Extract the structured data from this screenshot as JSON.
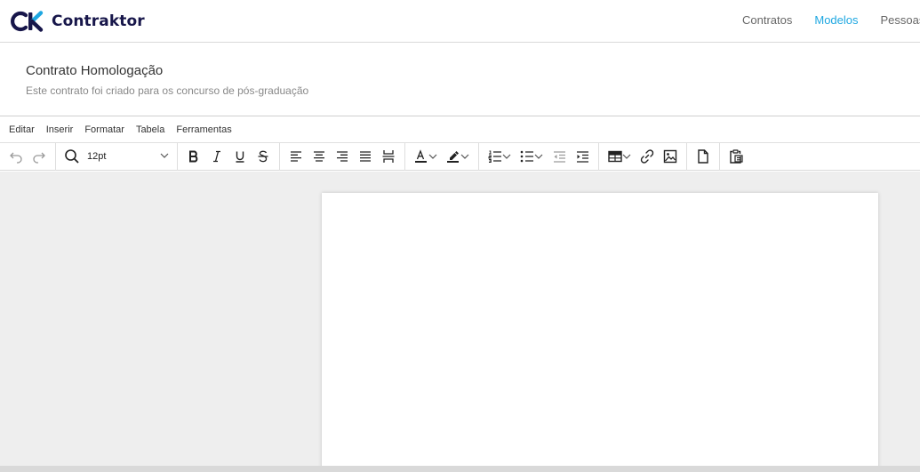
{
  "app": {
    "brand": "Contraktor",
    "brand_color": "#17164a",
    "accent_color": "#1ea7e1"
  },
  "nav": {
    "items": [
      {
        "label": "Contratos",
        "active": false
      },
      {
        "label": "Modelos",
        "active": true
      },
      {
        "label": "Pessoas",
        "active": false
      }
    ]
  },
  "document": {
    "title": "Contrato Homologação",
    "description": "Este contrato foi criado para os concurso de pós-graduação"
  },
  "editor": {
    "menu": [
      "Editar",
      "Inserir",
      "Formatar",
      "Tabela",
      "Ferramentas"
    ],
    "font_size": "12pt",
    "toolbar_icons": {
      "undo": "undo-icon",
      "redo": "redo-icon",
      "search": "search-icon",
      "bold": "bold-icon",
      "italic": "italic-icon",
      "underline": "underline-icon",
      "strikethrough": "strikethrough-icon",
      "align_left": "align-left-icon",
      "align_center": "align-center-icon",
      "align_right": "align-right-icon",
      "align_justify": "align-justify-icon",
      "page_break": "page-break-icon",
      "text_color": "text-color-icon",
      "highlight": "highlight-icon",
      "numbered_list": "numbered-list-icon",
      "bullet_list": "bullet-list-icon",
      "outdent": "outdent-icon",
      "indent": "indent-icon",
      "table": "table-icon",
      "link": "link-icon",
      "image": "image-icon",
      "document": "document-icon",
      "paste": "paste-icon"
    }
  }
}
